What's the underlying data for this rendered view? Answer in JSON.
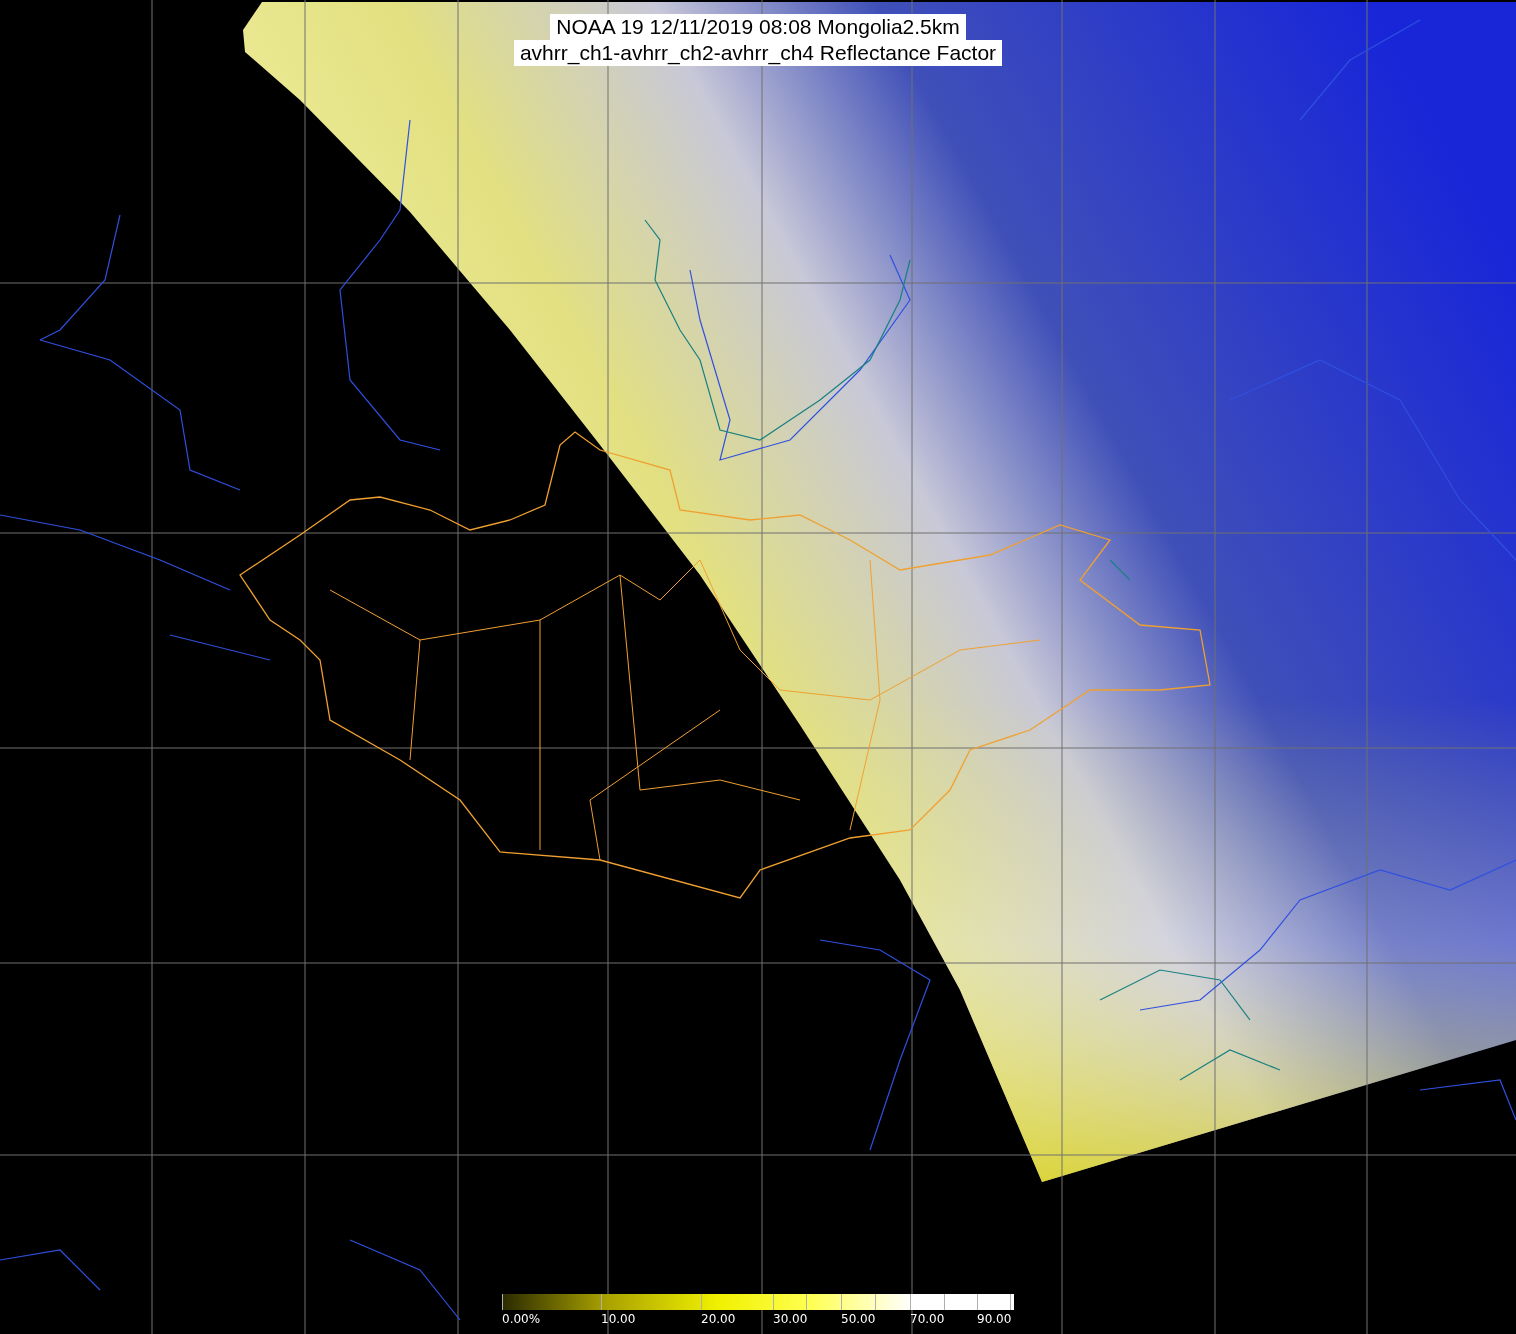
{
  "title": {
    "lines": [
      "NOAA 19 12/11/2019 08:08 Mongolia2.5km",
      "avhrr_ch1-avhrr_ch2-avhrr_ch4 Reflectance Factor"
    ]
  },
  "colorbar": {
    "labels": [
      "0.00%",
      "10.00",
      "20.00",
      "30.00",
      "50.00",
      "70.00",
      "90.00"
    ]
  }
}
